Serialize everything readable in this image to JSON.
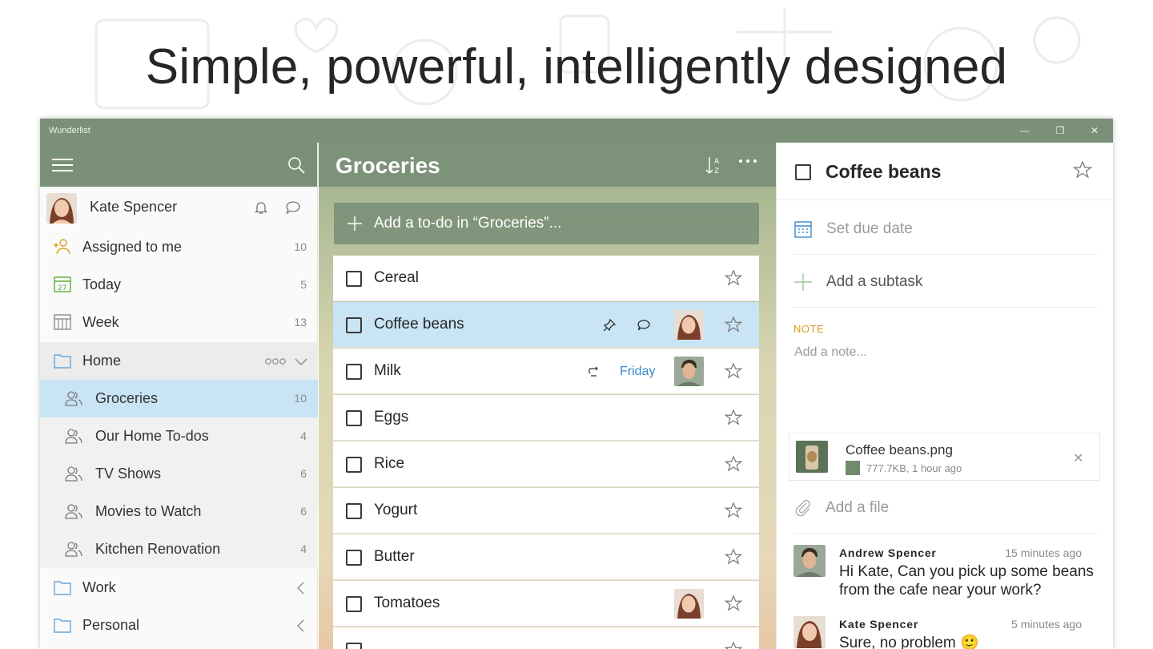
{
  "headline": "Simple, powerful, intelligently designed",
  "window": {
    "title": "Wunderlist",
    "controls": {
      "minimize": "—",
      "restore": "❐",
      "close": "✕"
    }
  },
  "sidebar": {
    "user": {
      "name": "Kate Spencer"
    },
    "smart_lists": [
      {
        "label": "Assigned to me",
        "count": "10",
        "icon": "assigned-icon"
      },
      {
        "label": "Today",
        "count": "5",
        "icon": "calendar-today-icon"
      },
      {
        "label": "Week",
        "count": "13",
        "icon": "calendar-week-icon"
      }
    ],
    "home_folder": {
      "label": "Home",
      "icon": "folder-icon"
    },
    "home_lists": [
      {
        "label": "Groceries",
        "count": "10"
      },
      {
        "label": "Our Home To-dos",
        "count": "4"
      },
      {
        "label": "TV Shows",
        "count": "6"
      },
      {
        "label": "Movies to Watch",
        "count": "6"
      },
      {
        "label": "Kitchen Renovation",
        "count": "4"
      }
    ],
    "other_folders": [
      {
        "label": "Work"
      },
      {
        "label": "Personal"
      }
    ]
  },
  "list": {
    "title": "Groceries",
    "add_placeholder": "Add a to-do in “Groceries”...",
    "tasks": [
      {
        "title": "Cereal"
      },
      {
        "title": "Coffee beans"
      },
      {
        "title": "Milk",
        "due": "Friday"
      },
      {
        "title": "Eggs"
      },
      {
        "title": "Rice"
      },
      {
        "title": "Yogurt"
      },
      {
        "title": "Butter"
      },
      {
        "title": "Tomatoes"
      }
    ]
  },
  "detail": {
    "title": "Coffee beans",
    "due_label": "Set due date",
    "subtask_label": "Add a subtask",
    "note_label": "NOTE",
    "note_placeholder": "Add a note...",
    "file": {
      "name": "Coffee beans.png",
      "meta": "777.7KB, 1 hour ago"
    },
    "add_file_label": "Add a file",
    "comments": [
      {
        "author": "Andrew Spencer",
        "time": "15 minutes ago",
        "text": "Hi Kate, Can you pick up some beans from the cafe near your work?"
      },
      {
        "author": "Kate Spencer",
        "time": "5 minutes ago",
        "text": "Sure, no problem 🙂"
      }
    ]
  },
  "colors": {
    "accent_green": "#7a9078",
    "selection_blue": "#c8e4f5",
    "due_blue": "#3a8ad0",
    "note_orange": "#d89a1a"
  }
}
